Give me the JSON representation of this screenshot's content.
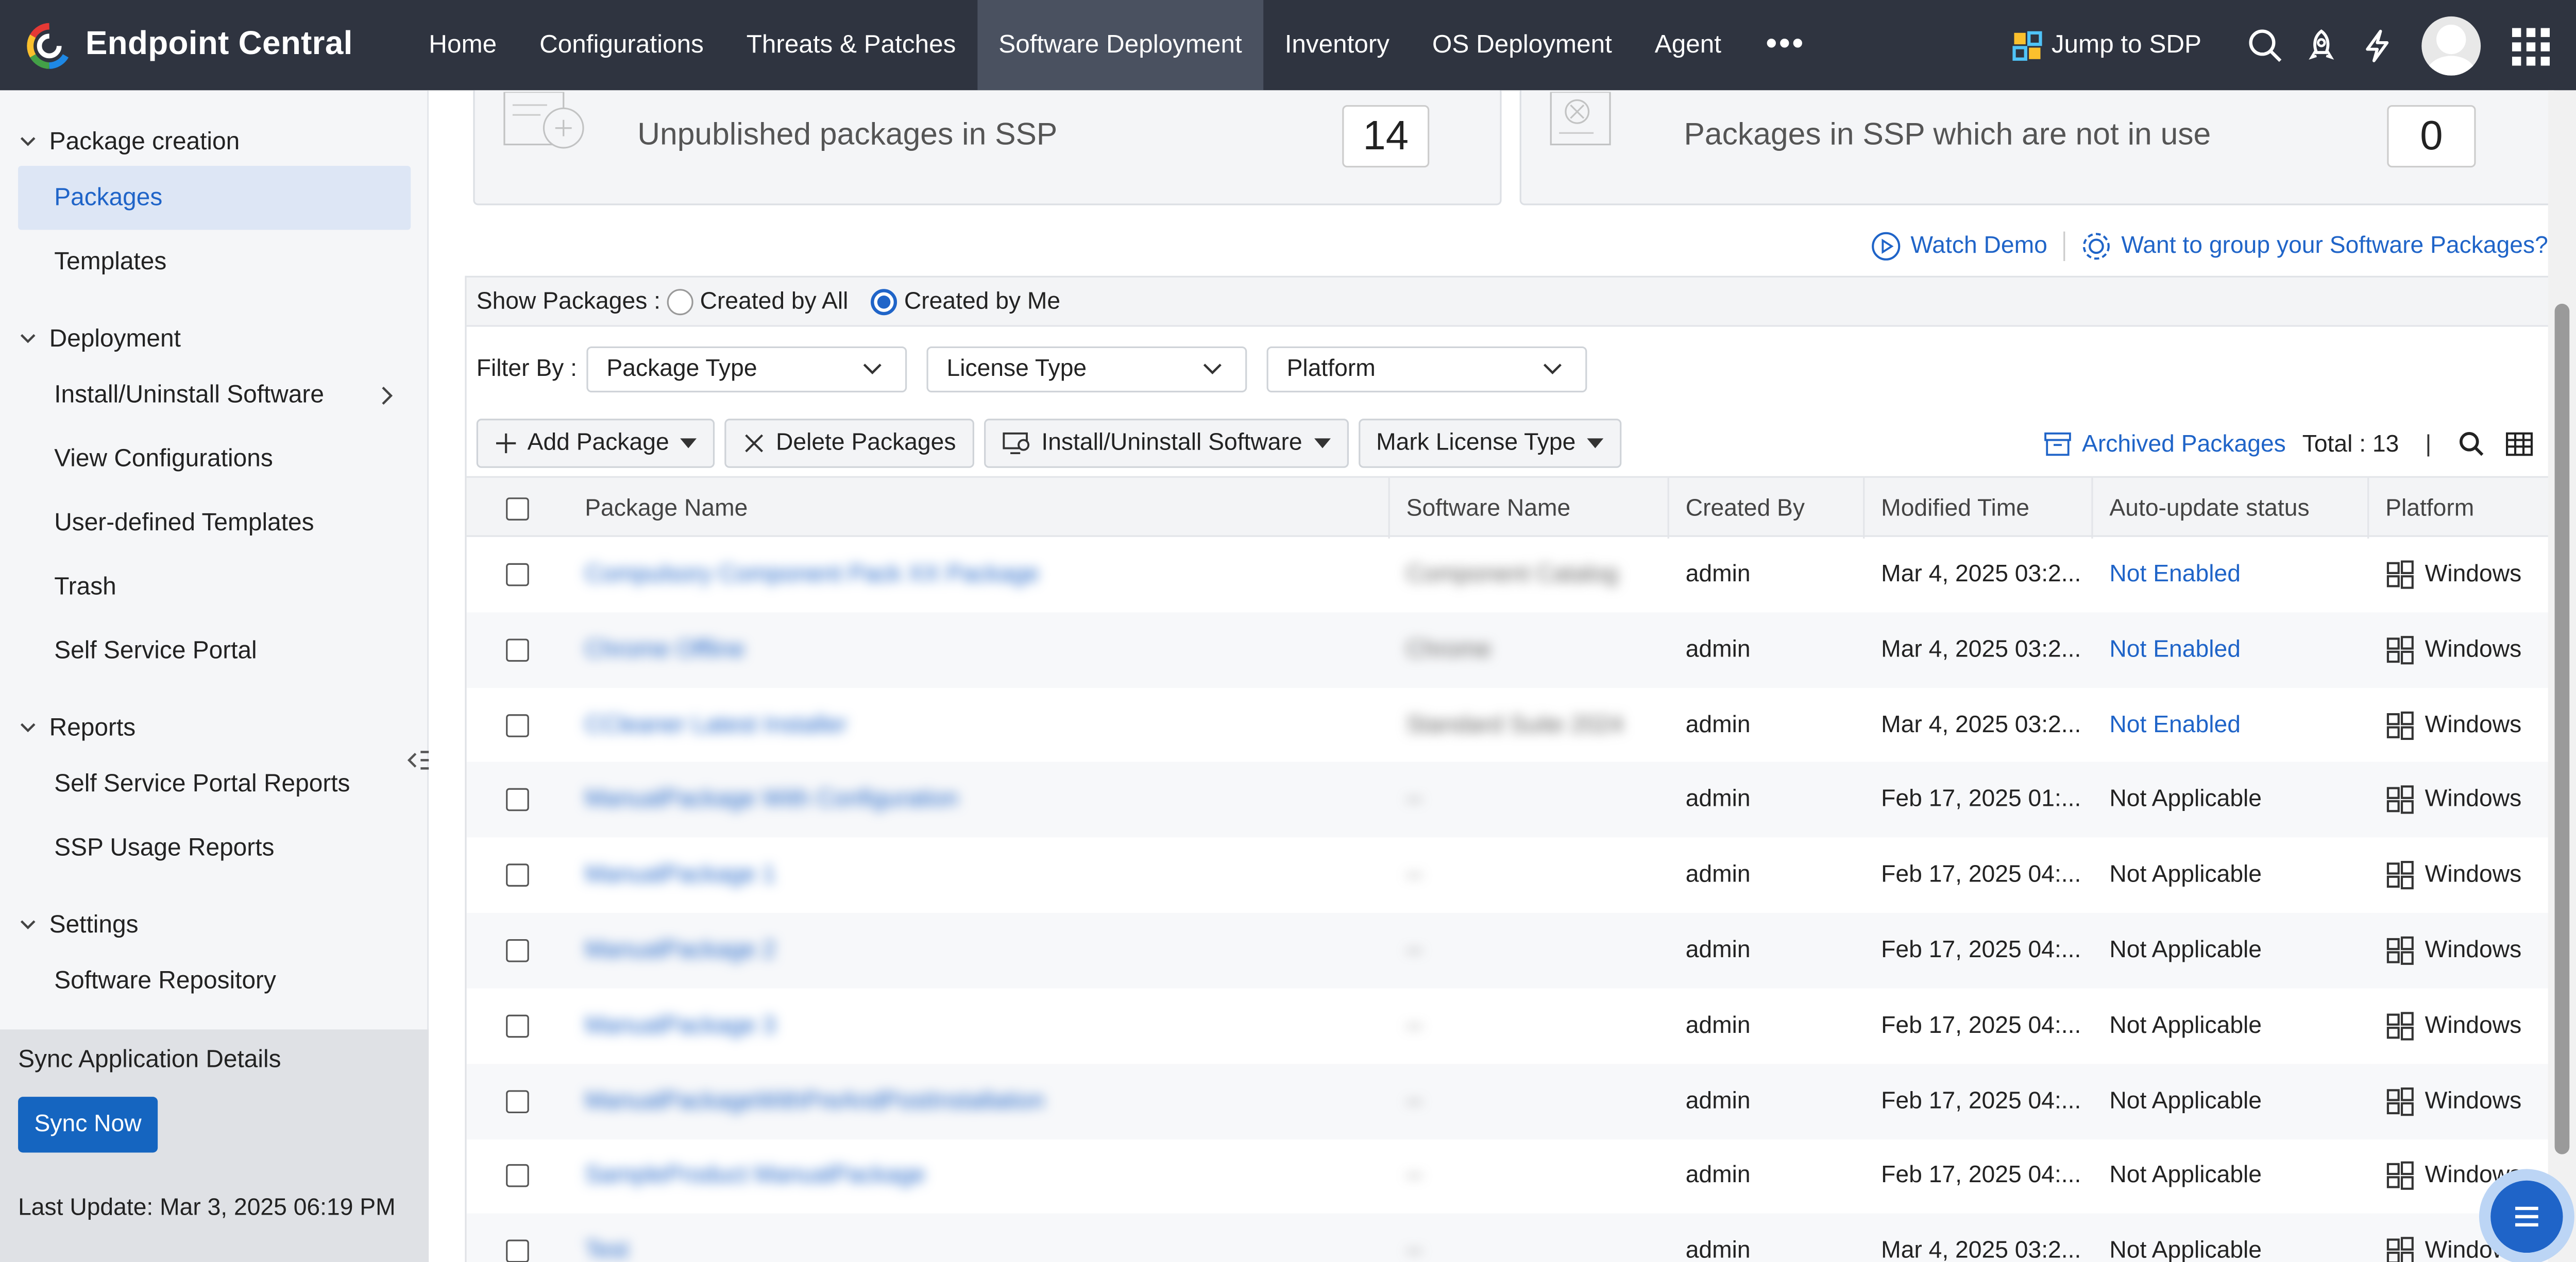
{
  "app": {
    "name": "Endpoint Central"
  },
  "nav": {
    "items": [
      "Home",
      "Configurations",
      "Threats & Patches",
      "Software Deployment",
      "Inventory",
      "OS Deployment",
      "Agent"
    ],
    "more": "•••",
    "jump": "Jump to SDP"
  },
  "sidebar": {
    "sec_package": "Package creation",
    "packages": "Packages",
    "templates": "Templates",
    "sec_deployment": "Deployment",
    "install": "Install/Uninstall Software",
    "view_config": "View Configurations",
    "user_templates": "User-defined Templates",
    "trash": "Trash",
    "ssp": "Self Service Portal",
    "sec_reports": "Reports",
    "ssp_reports": "Self Service Portal Reports",
    "ssp_usage": "SSP Usage Reports",
    "sec_settings": "Settings",
    "repo": "Software Repository",
    "sync_title": "Sync Application Details",
    "sync_btn": "Sync Now",
    "last_update": "Last Update: Mar 3, 2025 06:19 PM"
  },
  "cards": {
    "unpublished_label": "Unpublished packages in SSP",
    "unpublished_count": "14",
    "notinuse_label": "Packages in SSP which are not in use",
    "notinuse_count": "0"
  },
  "links": {
    "watch_demo": "Watch Demo",
    "group": "Want to group your Software Packages?"
  },
  "show": {
    "label": "Show Packages :",
    "opt_all": "Created by All",
    "opt_me": "Created by Me",
    "selected": "Created by Me"
  },
  "filter": {
    "label": "Filter By :",
    "package_type": "Package Type",
    "license_type": "License Type",
    "platform": "Platform"
  },
  "actions": {
    "add": "Add Package",
    "delete": "Delete Packages",
    "install": "Install/Uninstall Software",
    "mark": "Mark License Type",
    "archived": "Archived Packages",
    "total": "Total : 13",
    "divider": "|"
  },
  "table": {
    "headers": [
      "Package Name",
      "Software Name",
      "Created By",
      "Modified Time",
      "Auto-update status",
      "Platform"
    ],
    "rows": [
      {
        "name": "Compulsory Component Pack XX Package",
        "software": "Component Catalog",
        "by": "admin",
        "time": "Mar 4, 2025 03:2...",
        "status": "Not Enabled",
        "platform": "Windows"
      },
      {
        "name": "Chrome Offline",
        "software": "Chrome",
        "by": "admin",
        "time": "Mar 4, 2025 03:2...",
        "status": "Not Enabled",
        "platform": "Windows"
      },
      {
        "name": "CCleaner Latest Installer",
        "software": "Standard Suite 2024",
        "by": "admin",
        "time": "Mar 4, 2025 03:2...",
        "status": "Not Enabled",
        "platform": "Windows"
      },
      {
        "name": "ManualPackage With Configuration",
        "software": "--",
        "by": "admin",
        "time": "Feb 17, 2025 01:...",
        "status": "Not Applicable",
        "platform": "Windows"
      },
      {
        "name": "ManualPackage 1",
        "software": "--",
        "by": "admin",
        "time": "Feb 17, 2025 04:...",
        "status": "Not Applicable",
        "platform": "Windows"
      },
      {
        "name": "ManualPackage 2",
        "software": "--",
        "by": "admin",
        "time": "Feb 17, 2025 04:...",
        "status": "Not Applicable",
        "platform": "Windows"
      },
      {
        "name": "ManualPackage 3",
        "software": "--",
        "by": "admin",
        "time": "Feb 17, 2025 04:...",
        "status": "Not Applicable",
        "platform": "Windows"
      },
      {
        "name": "ManualPackageWithPreAndPostInstallation",
        "software": "--",
        "by": "admin",
        "time": "Feb 17, 2025 04:...",
        "status": "Not Applicable",
        "platform": "Windows"
      },
      {
        "name": "SampleProduct ManualPackage",
        "software": "--",
        "by": "admin",
        "time": "Feb 17, 2025 04:...",
        "status": "Not Applicable",
        "platform": "Windows"
      },
      {
        "name": "Test",
        "software": "--",
        "by": "admin",
        "time": "Mar 4, 2025 03:2...",
        "status": "Not Applicable",
        "platform": "Windows"
      }
    ]
  },
  "colors": {
    "topbar": "#2f3440",
    "accent": "#1f64c8",
    "sidebar_active": "#dde6f5"
  }
}
